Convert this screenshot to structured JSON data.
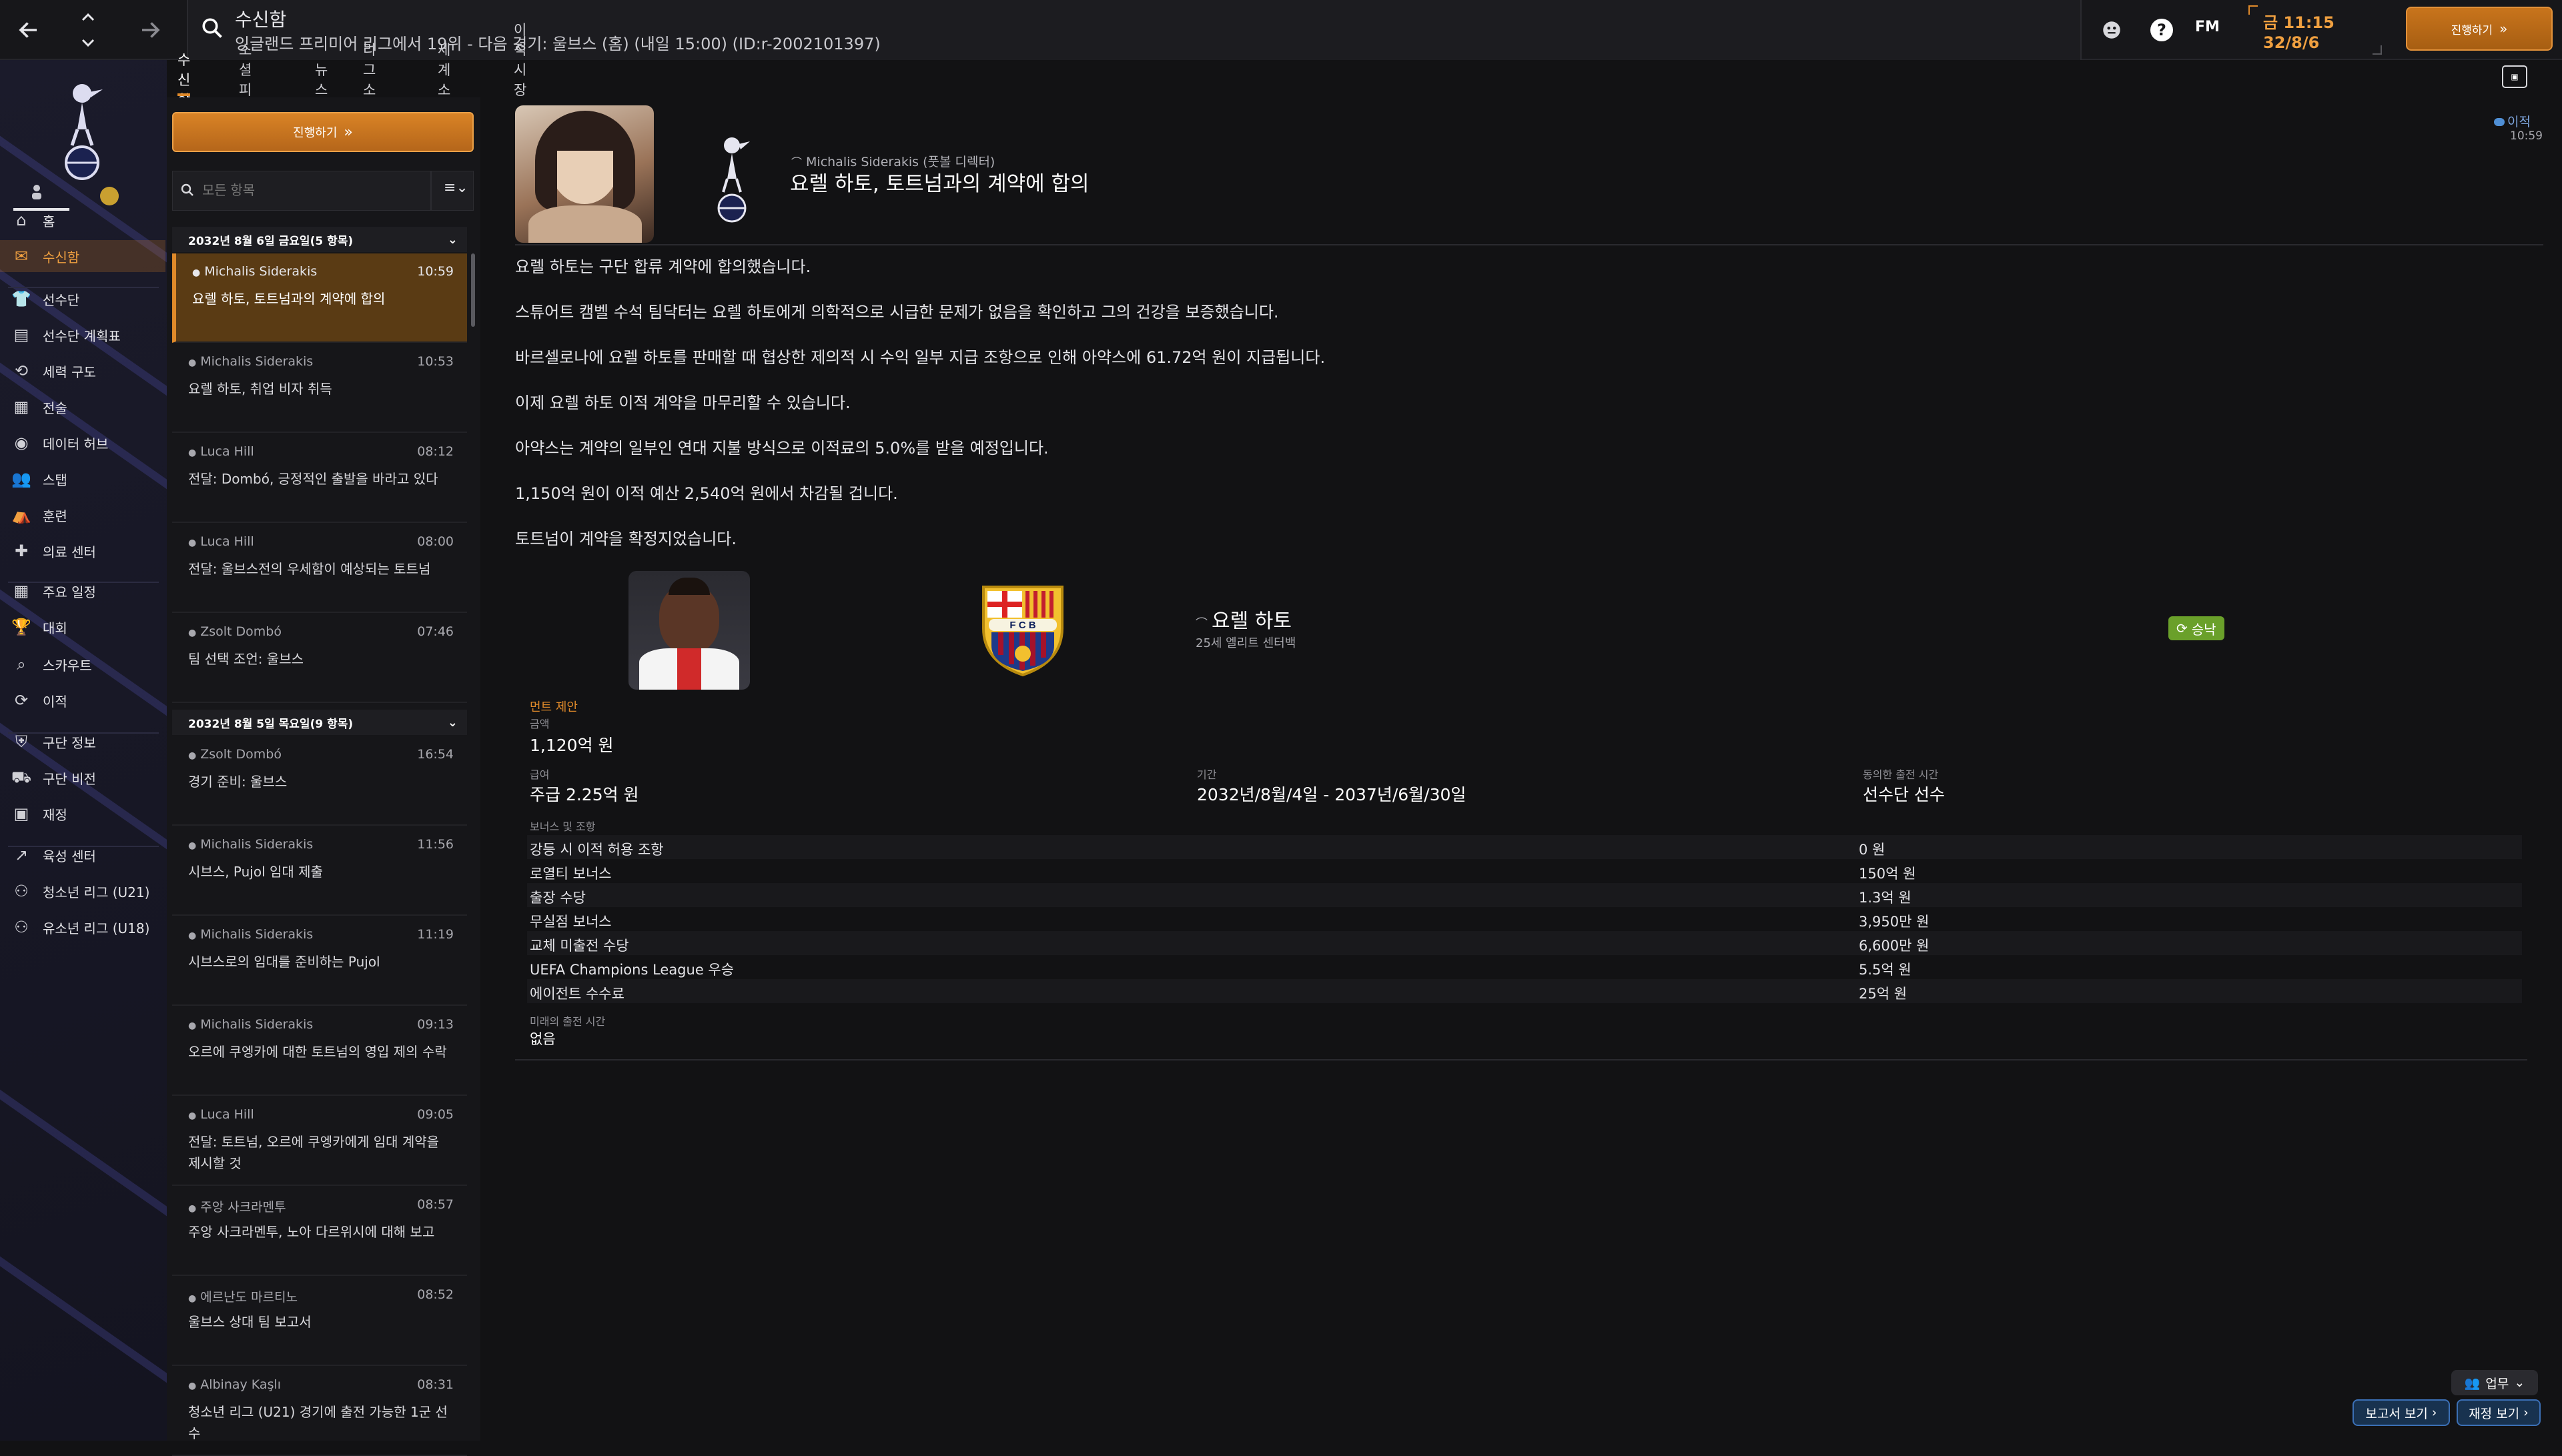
{
  "topbar": {
    "title": "수신함",
    "subtitle": "잉글랜드 프리미어 리그에서 19위 - 다음 경기: 울브스 (홈) (내일 15:00) (ID:r-2002101397)",
    "help_icon": "?",
    "fm_label": "FM",
    "time": "금 11:15",
    "date": "32/8/6",
    "continue_label": "진행하기"
  },
  "sidebar": {
    "items": [
      {
        "label": "홈",
        "icon": "home-icon"
      },
      {
        "label": "수신함",
        "icon": "inbox-icon"
      },
      {
        "label": "선수단",
        "icon": "squad-icon"
      },
      {
        "label": "선수단 계획표",
        "icon": "squad-planner-icon"
      },
      {
        "label": "세력 구도",
        "icon": "dynamics-icon"
      },
      {
        "label": "전술",
        "icon": "tactics-icon"
      },
      {
        "label": "데이터 허브",
        "icon": "data-hub-icon"
      },
      {
        "label": "스탭",
        "icon": "staff-icon"
      },
      {
        "label": "훈련",
        "icon": "training-icon"
      },
      {
        "label": "의료 센터",
        "icon": "medical-icon"
      },
      {
        "label": "주요 일정",
        "icon": "schedule-icon"
      },
      {
        "label": "대회",
        "icon": "trophy-icon"
      },
      {
        "label": "스카우트",
        "icon": "scouting-icon"
      },
      {
        "label": "이적",
        "icon": "transfers-icon"
      },
      {
        "label": "구단 정보",
        "icon": "club-info-icon"
      },
      {
        "label": "구단 비전",
        "icon": "club-vision-icon"
      },
      {
        "label": "재정",
        "icon": "finances-icon"
      },
      {
        "label": "육성 센터",
        "icon": "development-icon"
      },
      {
        "label": "청소년 리그 (U21)",
        "icon": "u21-icon"
      },
      {
        "label": "유소년 리그 (U18)",
        "icon": "u18-icon"
      }
    ]
  },
  "tabs": [
    "수신함",
    "소셜 피드",
    "뉴스",
    "리그 소식",
    "세계 소식",
    "이적 시장 뉴스"
  ],
  "inbox": {
    "continue_label": "진행하기",
    "filter_placeholder": "모든 항목",
    "groups": [
      {
        "date": "2032년 8월 6일 금요일(5 항목)",
        "messages": [
          {
            "sender": "Michalis Siderakis",
            "time": "10:59",
            "subject": "요렐 하토, 토트넘과의 계약에 합의"
          },
          {
            "sender": "Michalis Siderakis",
            "time": "10:53",
            "subject": "요렐 하토, 취업 비자 취득"
          },
          {
            "sender": "Luca Hill",
            "time": "08:12",
            "subject": "전달: Dombó, 긍정적인 출발을 바라고 있다"
          },
          {
            "sender": "Luca Hill",
            "time": "08:00",
            "subject": "전달: 울브스전의 우세함이 예상되는 토트넘"
          },
          {
            "sender": "Zsolt Dombó",
            "time": "07:46",
            "subject": "팀 선택 조언: 울브스"
          }
        ]
      },
      {
        "date": "2032년 8월 5일 목요일(9 항목)",
        "messages": [
          {
            "sender": "Zsolt Dombó",
            "time": "16:54",
            "subject": "경기 준비: 울브스"
          },
          {
            "sender": "Michalis Siderakis",
            "time": "11:56",
            "subject": "시브스, Pujol 임대 제출"
          },
          {
            "sender": "Michalis Siderakis",
            "time": "11:19",
            "subject": "시브스로의 임대를 준비하는 Pujol"
          },
          {
            "sender": "Michalis Siderakis",
            "time": "09:13",
            "subject": "오르에 쿠엥카에 대한 토트넘의 영입 제의 수락"
          },
          {
            "sender": "Luca Hill",
            "time": "09:05",
            "subject": "전달: 토트넘, 오르에 쿠엥카에게 임대 계약을 제시할 것"
          },
          {
            "sender": "주앙 사크라멘투",
            "time": "08:57",
            "subject": "주앙 사크라멘투, 노아 다르위시에 대해 보고"
          },
          {
            "sender": "에르난도 마르티노",
            "time": "08:52",
            "subject": "울브스 상대 팀 보고서"
          },
          {
            "sender": "Albinay Kaşlı",
            "time": "08:31",
            "subject": "청소년 리그 (U21) 경기에 출전 가능한 1군 선수"
          }
        ]
      }
    ]
  },
  "message": {
    "sender_line": "Michalis Siderakis (풋볼 디렉터)",
    "title": "요렐 하토, 토트넘과의 계약에 합의",
    "tag": "이적",
    "tag_time": "10:59",
    "paragraphs": [
      "요렐 하토는 구단 합류 계약에 합의했습니다.",
      "스튜어트 캠벨 수석 팀닥터는 요렐 하토에게 의학적으로 시급한 문제가 없음을 확인하고 그의 건강을 보증했습니다.",
      "바르셀로나에 요렐 하토를 판매할 때 협상한 제의적 시 수익 일부 지급 조항으로 인해 아약스에 61.72억 원이 지급됩니다.",
      "이제 요렐 하토 이적 계약을 마무리할 수 있습니다.",
      "아약스는 계약의 일부인 연대 지불 방식으로 이적료의 5.0%를 받을 예정입니다.",
      "1,150억 원이 이적 예산 2,540억 원에서 차감될 겁니다.",
      "토트넘이 계약을 확정지었습니다."
    ],
    "player": {
      "name": "요렐 하토",
      "desc": "25세 엘리트 센터백",
      "status": "승낙"
    },
    "offer_title": "먼트 제안",
    "fee_label": "금액",
    "fee_value": "1,120억 원",
    "wage_label": "급여",
    "wage_value": "주급 2.25억 원",
    "period_label": "기간",
    "period_value": "2032년/8월/4일 - 2037년/6월/30일",
    "playing_time_label": "동의한 출전 시간",
    "playing_time_value": "선수단 선수",
    "bonus_header": "보너스 및 조항",
    "bonuses": [
      {
        "label": "강등 시 이적 허용 조항",
        "value": "0 원"
      },
      {
        "label": "로열티 보너스",
        "value": "150억 원"
      },
      {
        "label": "출장 수당",
        "value": "1.3억 원"
      },
      {
        "label": "무실점 보너스",
        "value": "3,950만 원"
      },
      {
        "label": "교체 미출전 수당",
        "value": "6,600만 원"
      },
      {
        "label": "UEFA Champions League 우승",
        "value": "5.5억 원"
      },
      {
        "label": "에이전트 수수료",
        "value": "25억 원"
      }
    ],
    "future_label": "미래의 출전 시간",
    "future_value": "없음"
  },
  "bottom": {
    "work_label": "업무",
    "report_label": "보고서 보기",
    "finance_label": "재정 보기"
  },
  "colors": {
    "accent": "#e08a2a",
    "accept": "#6aa02a",
    "link_blue": "#3b6fb5"
  }
}
